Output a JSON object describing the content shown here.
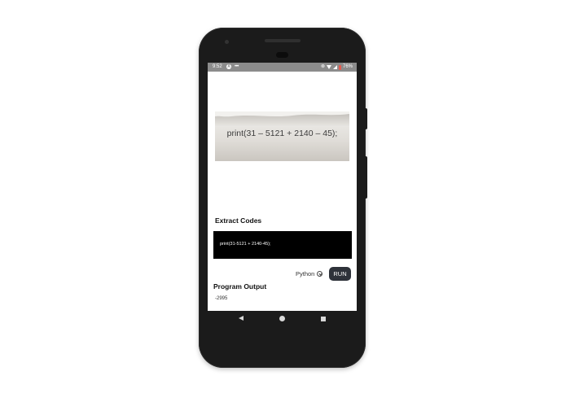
{
  "status_bar": {
    "time": "9:52",
    "app_icon_letter": "A",
    "more": "•••",
    "battery": "76%",
    "icons": [
      "no-signal-icon",
      "wifi-icon",
      "signal-icon",
      "battery-icon"
    ]
  },
  "captured_image": {
    "text": "print(31 – 5121 + 2140 – 45);"
  },
  "extract": {
    "title": "Extract Codes",
    "code": "print(31-5121 + 2140-45);"
  },
  "controls": {
    "language": "Python",
    "run_label": "RUN"
  },
  "output": {
    "title": "Program Output",
    "value": "-2995"
  },
  "colors": {
    "status_bar": "#8c8c8c",
    "code_bg": "#000000",
    "run_button": "#2e323a",
    "phone_body": "#1b1b1b"
  }
}
